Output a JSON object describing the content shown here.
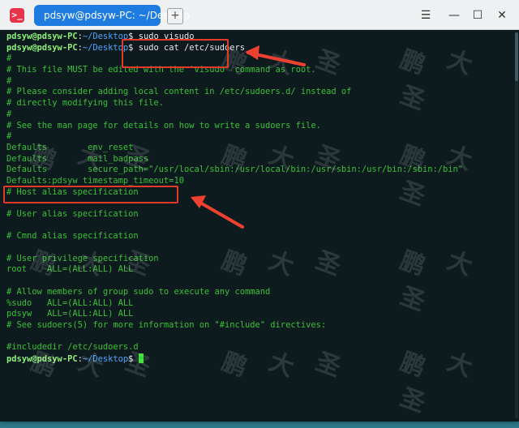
{
  "window": {
    "tab_title": "pdsyw@pdsyw-PC: ~/Desktop",
    "new_tab": "+",
    "app_icon": ">_"
  },
  "prompt": {
    "user": "pdsyw@pdsyw-PC",
    "sep": ":",
    "path": "~/Desktop",
    "sym": "$"
  },
  "terminal": {
    "cmd1": " sudo visudo",
    "cmd2": " sudo cat /etc/sudoers",
    "output": [
      "#",
      "# This file MUST be edited with the 'visudo' command as root.",
      "#",
      "# Please consider adding local content in /etc/sudoers.d/ instead of",
      "# directly modifying this file.",
      "#",
      "# See the man page for details on how to write a sudoers file.",
      "#",
      "Defaults        env_reset",
      "Defaults        mail_badpass",
      "Defaults        secure_path=\"/usr/local/sbin:/usr/local/bin:/usr/sbin:/usr/bin:/sbin:/bin\"",
      "Defaults:pdsyw timestamp_timeout=10",
      "# Host alias specification",
      "",
      "# User alias specification",
      "",
      "# Cmnd alias specification",
      "",
      "# User privilege specification",
      "root    ALL=(ALL:ALL) ALL",
      "",
      "# Allow members of group sudo to execute any command",
      "%sudo   ALL=(ALL:ALL) ALL",
      "pdsyw   ALL=(ALL:ALL) ALL",
      "# See sudoers(5) for more information on \"#include\" directives:",
      "",
      "#includedir /etc/sudoers.d"
    ]
  },
  "watermark": {
    "chars": [
      "鹏",
      "大",
      "圣"
    ]
  },
  "colors": {
    "accent": "#1e7ce0",
    "annotation": "#e53a2a",
    "terminal_bg": "#0d1b1e"
  }
}
